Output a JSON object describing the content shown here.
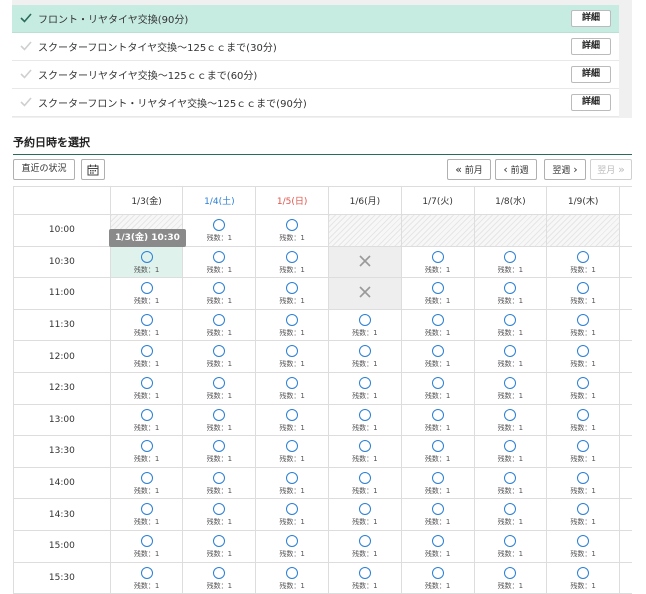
{
  "menus": [
    {
      "label": "フロント・リヤタイヤ交換(90分)",
      "detail": "詳細",
      "selected": true
    },
    {
      "label": "スクーターフロントタイヤ交換～125ｃｃまで(30分)",
      "detail": "詳細",
      "selected": false
    },
    {
      "label": "スクーターリヤタイヤ交換～125ｃｃまで(60分)",
      "detail": "詳細",
      "selected": false
    },
    {
      "label": "スクーターフロント・リヤタイヤ交換～125ｃｃまで(90分)",
      "detail": "詳細",
      "selected": false
    }
  ],
  "section_title": "予約日時を選択",
  "toolbar": {
    "recent_label": "直近の状況",
    "calendar_icon": "calendar-icon",
    "prev_month": "前月",
    "prev_week": "前週",
    "next_week": "翌週",
    "next_month": "翌月"
  },
  "days": [
    {
      "label": "1/3(金)",
      "type": "weekday"
    },
    {
      "label": "1/4(土)",
      "type": "sat"
    },
    {
      "label": "1/5(日)",
      "type": "sun"
    },
    {
      "label": "1/6(月)",
      "type": "weekday"
    },
    {
      "label": "1/7(火)",
      "type": "weekday"
    },
    {
      "label": "1/8(水)",
      "type": "weekday"
    },
    {
      "label": "1/9(木)",
      "type": "weekday"
    }
  ],
  "times": [
    "10:00",
    "10:30",
    "11:00",
    "11:30",
    "12:00",
    "12:30",
    "13:00",
    "13:30",
    "14:00",
    "14:30",
    "15:00",
    "15:30"
  ],
  "remaining_label": "残数：1",
  "tooltip": "1/3(金) 10:30",
  "status_colors": {
    "available": "#2a7fd6",
    "selected_bg": "#dff2ec",
    "closed": "#999999"
  },
  "slots": [
    [
      "na",
      "avail",
      "avail",
      "na",
      "na",
      "na",
      "na"
    ],
    [
      "selected",
      "avail",
      "avail",
      "closed",
      "avail",
      "avail",
      "avail"
    ],
    [
      "avail",
      "avail",
      "avail",
      "closed",
      "avail",
      "avail",
      "avail"
    ],
    [
      "avail",
      "avail",
      "avail",
      "avail",
      "avail",
      "avail",
      "avail"
    ],
    [
      "avail",
      "avail",
      "avail",
      "avail",
      "avail",
      "avail",
      "avail"
    ],
    [
      "avail",
      "avail",
      "avail",
      "avail",
      "avail",
      "avail",
      "avail"
    ],
    [
      "avail",
      "avail",
      "avail",
      "avail",
      "avail",
      "avail",
      "avail"
    ],
    [
      "avail",
      "avail",
      "avail",
      "avail",
      "avail",
      "avail",
      "avail"
    ],
    [
      "avail",
      "avail",
      "avail",
      "avail",
      "avail",
      "avail",
      "avail"
    ],
    [
      "avail",
      "avail",
      "avail",
      "avail",
      "avail",
      "avail",
      "avail"
    ],
    [
      "avail",
      "avail",
      "avail",
      "avail",
      "avail",
      "avail",
      "avail"
    ],
    [
      "avail",
      "avail",
      "avail",
      "avail",
      "avail",
      "avail",
      "avail"
    ]
  ]
}
